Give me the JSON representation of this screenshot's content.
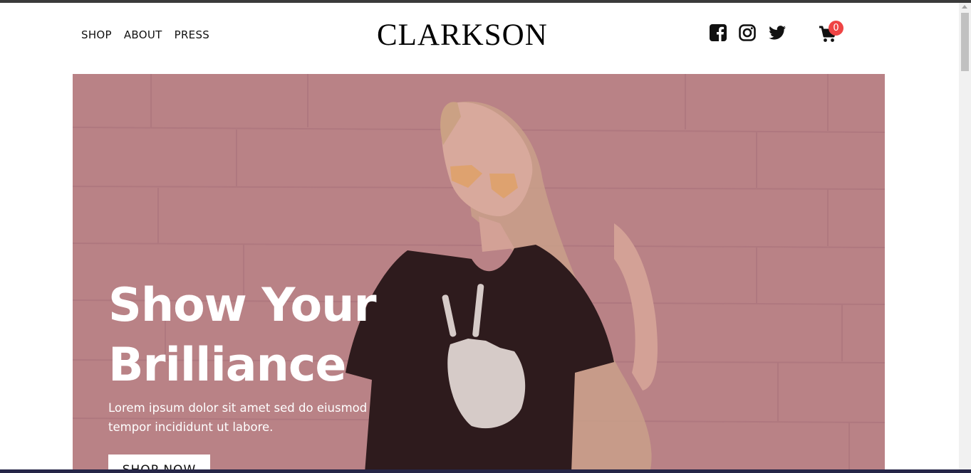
{
  "nav": {
    "items": [
      {
        "label": "SHOP"
      },
      {
        "label": "ABOUT"
      },
      {
        "label": "PRESS"
      }
    ]
  },
  "brand": {
    "logo": "CLARKSON"
  },
  "social": {
    "icons": [
      "facebook-square-icon",
      "instagram-icon",
      "twitter-icon"
    ]
  },
  "cart": {
    "icon": "shopping-cart-icon",
    "count": "0"
  },
  "hero": {
    "title_line1": "Show Your",
    "title_line2": "Brilliance",
    "subtitle": "Lorem ipsum dolor sit amet sed do eiusmod tempor incididunt ut labore.",
    "button_label": "SHOP NOW"
  },
  "colors": {
    "badge": "#ef4444",
    "hero_tint": "#b98286",
    "text_dark": "#111111"
  }
}
